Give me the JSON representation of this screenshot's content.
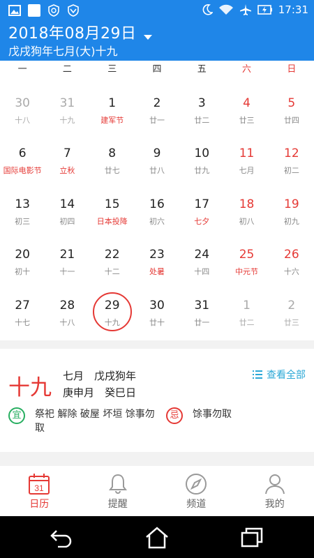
{
  "status": {
    "time": "17:31",
    "left_icons": [
      "image-icon",
      "white-square-icon",
      "refresh-shield-icon",
      "vee-shield-icon"
    ],
    "right_icons": [
      "moon-icon",
      "wifi-icon",
      "airplane-icon",
      "battery-icon"
    ]
  },
  "header": {
    "date": "2018年08月29日",
    "lunar": "戊戌狗年七月(大)十九"
  },
  "weekdays": [
    "一",
    "二",
    "三",
    "四",
    "五",
    "六",
    "日"
  ],
  "calendar": [
    [
      {
        "day": "30",
        "lunar": "十八",
        "other": true
      },
      {
        "day": "31",
        "lunar": "十九",
        "other": true
      },
      {
        "day": "1",
        "lunar": "建军节",
        "fest": true
      },
      {
        "day": "2",
        "lunar": "廿一"
      },
      {
        "day": "3",
        "lunar": "廿二"
      },
      {
        "day": "4",
        "lunar": "廿三",
        "weekend": true
      },
      {
        "day": "5",
        "lunar": "廿四",
        "weekend": true
      }
    ],
    [
      {
        "day": "6",
        "lunar": "国际电影节",
        "fest": true
      },
      {
        "day": "7",
        "lunar": "立秋",
        "fest": true
      },
      {
        "day": "8",
        "lunar": "廿七"
      },
      {
        "day": "9",
        "lunar": "廿八"
      },
      {
        "day": "10",
        "lunar": "廿九"
      },
      {
        "day": "11",
        "lunar": "七月",
        "weekend": true
      },
      {
        "day": "12",
        "lunar": "初二",
        "weekend": true
      }
    ],
    [
      {
        "day": "13",
        "lunar": "初三"
      },
      {
        "day": "14",
        "lunar": "初四"
      },
      {
        "day": "15",
        "lunar": "日本投降",
        "fest": true
      },
      {
        "day": "16",
        "lunar": "初六"
      },
      {
        "day": "17",
        "lunar": "七夕",
        "fest": true
      },
      {
        "day": "18",
        "lunar": "初八",
        "weekend": true
      },
      {
        "day": "19",
        "lunar": "初九",
        "weekend": true
      }
    ],
    [
      {
        "day": "20",
        "lunar": "初十"
      },
      {
        "day": "21",
        "lunar": "十一"
      },
      {
        "day": "22",
        "lunar": "十二"
      },
      {
        "day": "23",
        "lunar": "处暑",
        "fest": true
      },
      {
        "day": "24",
        "lunar": "十四"
      },
      {
        "day": "25",
        "lunar": "中元节",
        "weekend": true,
        "fest": true
      },
      {
        "day": "26",
        "lunar": "十六",
        "weekend": true
      }
    ],
    [
      {
        "day": "27",
        "lunar": "十七"
      },
      {
        "day": "28",
        "lunar": "十八"
      },
      {
        "day": "29",
        "lunar": "十九",
        "selected": true
      },
      {
        "day": "30",
        "lunar": "廿十"
      },
      {
        "day": "31",
        "lunar": "廿一"
      },
      {
        "day": "1",
        "lunar": "廿二",
        "other": true
      },
      {
        "day": "2",
        "lunar": "廿三",
        "other": true
      }
    ]
  ],
  "info": {
    "big_day": "十九",
    "line1": "七月　戊戌狗年",
    "line2": "庚申月　癸巳日",
    "view_all": "查看全部",
    "yi_label": "宜",
    "yi_text": "祭祀 解除 破屋 坏垣 馀事勿取",
    "ji_label": "忌",
    "ji_text": "馀事勿取"
  },
  "nav": [
    {
      "label": "日历",
      "icon": "calendar-icon",
      "active": true,
      "num": "31"
    },
    {
      "label": "提醒",
      "icon": "bell-icon"
    },
    {
      "label": "频道",
      "icon": "compass-icon"
    },
    {
      "label": "我的",
      "icon": "person-icon"
    }
  ],
  "colors": {
    "primary": "#1f86e8",
    "accent_red": "#e53935",
    "green": "#27ae60",
    "link": "#2aa7d6"
  }
}
